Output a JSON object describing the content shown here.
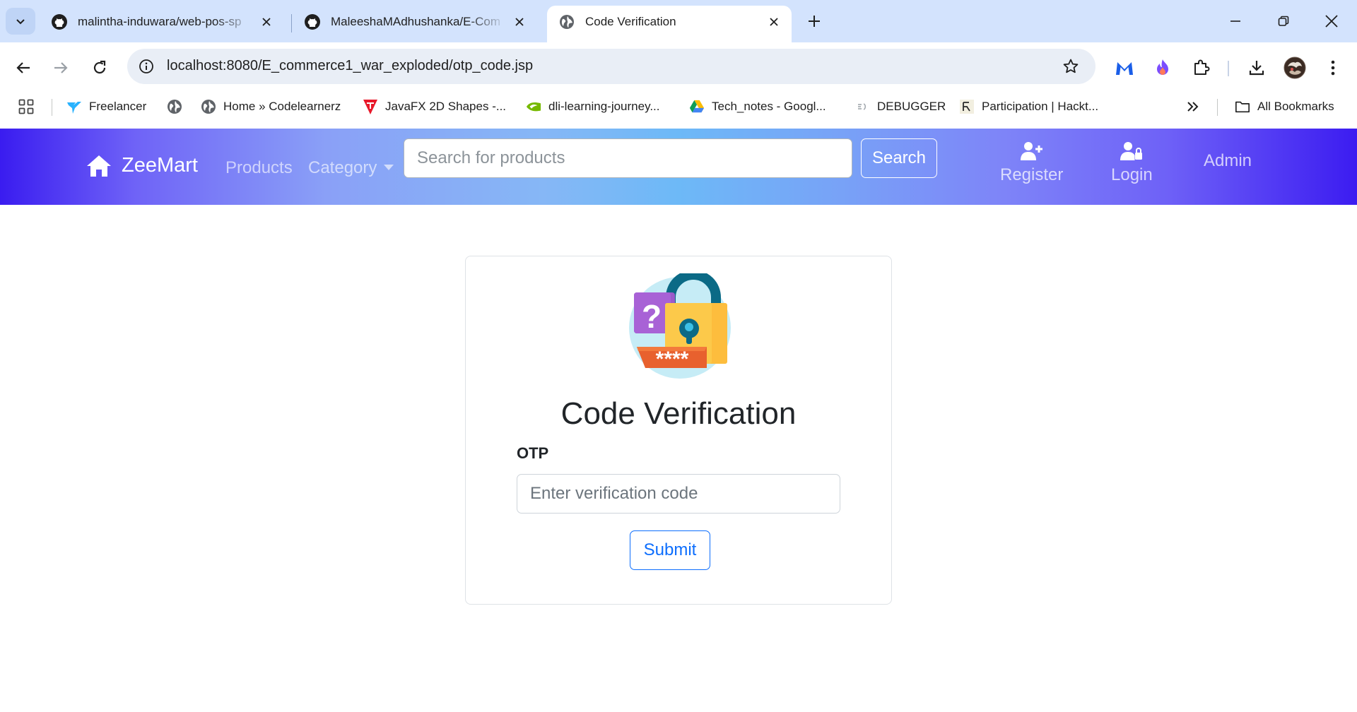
{
  "browser": {
    "tabs": [
      {
        "title": "malintha-induwara/web-pos-sp",
        "favicon": "github-icon",
        "active": false
      },
      {
        "title": "MaleeshaMAdhushanka/E-Com",
        "favicon": "github-icon",
        "active": false
      },
      {
        "title": "Code Verification",
        "favicon": "globe-icon",
        "active": true
      }
    ],
    "url": "localhost:8080/E_commerce1_war_exploded/otp_code.jsp",
    "bookmarks": [
      {
        "label": "Freelancer",
        "icon": "freelancer-bird-icon"
      },
      {
        "label": "",
        "icon": "globe-icon"
      },
      {
        "label": "Home » Codelearnerz",
        "icon": "globe-icon"
      },
      {
        "label": "JavaFX 2D Shapes -...",
        "icon": "javatpoint-icon"
      },
      {
        "label": "dli-learning-journey...",
        "icon": "nvidia-icon"
      },
      {
        "label": "Tech_notes - Googl...",
        "icon": "google-drive-icon"
      },
      {
        "label": "DEBUGGER",
        "icon": "debugger-icon"
      },
      {
        "label": "Participation | Hackt...",
        "icon": "hackerrank-icon"
      }
    ],
    "all_bookmarks_label": "All Bookmarks"
  },
  "site": {
    "brand": "ZeeMart",
    "nav": {
      "products": "Products",
      "category": "Category",
      "register": "Register",
      "login": "Login",
      "admin": "Admin"
    },
    "search": {
      "placeholder": "Search for products",
      "button": "Search"
    },
    "card": {
      "title": "Code Verification",
      "otp_label": "OTP",
      "otp_placeholder": "Enter verification code",
      "submit": "Submit",
      "illustration_text": "****"
    }
  },
  "colors": {
    "nav_gradient_edge": "#3a1cf0",
    "nav_gradient_center": "#6db9f7",
    "primary": "#0d6efd",
    "tab_strip": "#d3e3fd"
  }
}
